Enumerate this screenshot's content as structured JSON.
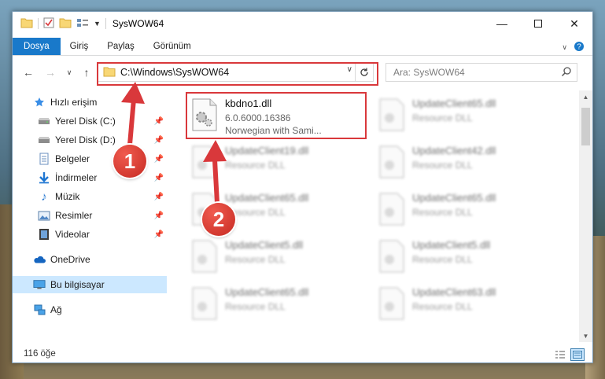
{
  "window": {
    "title": "SysWOW64"
  },
  "ribbon": {
    "tabs": [
      "Dosya",
      "Giriş",
      "Paylaş",
      "Görünüm"
    ]
  },
  "address": {
    "path": "C:\\Windows\\SysWOW64"
  },
  "search": {
    "placeholder": "Ara: SysWOW64"
  },
  "nav": {
    "items": [
      {
        "label": "Hızlı erişim",
        "icon": "star-icon",
        "pinned": false
      },
      {
        "label": "Yerel Disk (C:)",
        "icon": "drive-icon",
        "pinned": true
      },
      {
        "label": "Yerel Disk (D:)",
        "icon": "drive-icon",
        "pinned": true
      },
      {
        "label": "Belgeler",
        "icon": "documents-icon",
        "pinned": true
      },
      {
        "label": "İndirmeler",
        "icon": "download-icon",
        "pinned": true
      },
      {
        "label": "Müzik",
        "icon": "music-icon",
        "pinned": true
      },
      {
        "label": "Resimler",
        "icon": "pictures-icon",
        "pinned": true
      },
      {
        "label": "Videolar",
        "icon": "videos-icon",
        "pinned": true
      },
      {
        "label": "OneDrive",
        "icon": "cloud-icon",
        "pinned": false
      },
      {
        "label": "Bu bilgisayar",
        "icon": "computer-icon",
        "pinned": false,
        "selected": true
      },
      {
        "label": "Ağ",
        "icon": "network-icon",
        "pinned": false
      }
    ]
  },
  "files": [
    {
      "name": "kbdno1.dll",
      "version": "6.0.6000.16386",
      "desc": "Norwegian with Sami...",
      "highlighted": true
    },
    {
      "name": "UpdateClient65.dll",
      "desc": "Resource DLL"
    },
    {
      "name": "UpdateClient19.dll",
      "desc": "Resource DLL"
    },
    {
      "name": "UpdateClient42.dll",
      "desc": "Resource DLL"
    },
    {
      "name": "UpdateClient65.dll",
      "desc": "Resource DLL"
    },
    {
      "name": "UpdateClient65.dll",
      "desc": "Resource DLL"
    },
    {
      "name": "UpdateClient5.dll",
      "desc": "Resource DLL"
    },
    {
      "name": "UpdateClient5.dll",
      "desc": "Resource DLL"
    },
    {
      "name": "UpdateClient65.dll",
      "desc": "Resource DLL"
    },
    {
      "name": "UpdateClient63.dll",
      "desc": "Resource DLL"
    }
  ],
  "status": {
    "count": "116 öğe"
  },
  "annotations": {
    "step1": "1",
    "step2": "2"
  },
  "colors": {
    "accent": "#1979ca",
    "highlight": "#d9383b"
  }
}
